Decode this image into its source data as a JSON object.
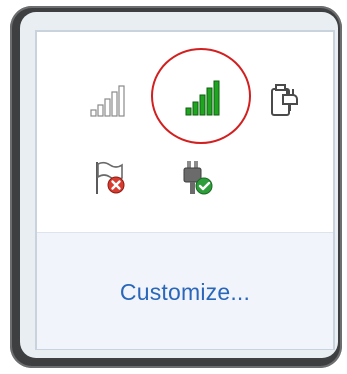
{
  "tray_popup": {
    "customize_label": "Customize..."
  },
  "icons": [
    {
      "name": "wifi-signal-weak-icon",
      "state": "not connected"
    },
    {
      "name": "wifi-signal-full-icon",
      "state": "connected",
      "highlighted": true
    },
    {
      "name": "power-plug-battery-icon"
    },
    {
      "name": "action-center-flag-error-icon"
    },
    {
      "name": "safely-remove-hardware-icon"
    }
  ],
  "colors": {
    "signal_green": "#1fa51f",
    "signal_grey": "#9a9a9a",
    "link_blue": "#2a66b9",
    "highlight_red": "#d21f1f",
    "error_red": "#d83b2f",
    "check_green": "#2e9e3a"
  }
}
